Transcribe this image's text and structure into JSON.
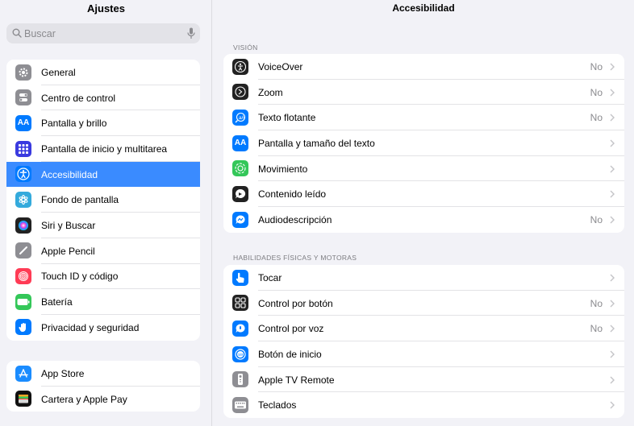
{
  "sidebar": {
    "title": "Ajustes",
    "search_placeholder": "Buscar",
    "items": [
      {
        "label": "General",
        "icon": "gear-icon",
        "color": "#8e8e93"
      },
      {
        "label": "Centro de control",
        "icon": "toggles-icon",
        "color": "#8e8e93"
      },
      {
        "label": "Pantalla y brillo",
        "icon": "text-size-icon",
        "color": "#007aff"
      },
      {
        "label": "Pantalla de inicio y multitarea",
        "icon": "grid-icon",
        "color": "#3a3adf"
      },
      {
        "label": "Accesibilidad",
        "icon": "accessibility-icon",
        "color": "#007aff"
      },
      {
        "label": "Fondo de pantalla",
        "icon": "flower-icon",
        "color": "#34aadc"
      },
      {
        "label": "Siri y Buscar",
        "icon": "siri-icon",
        "color": "#222222"
      },
      {
        "label": "Apple Pencil",
        "icon": "pencil-icon",
        "color": "#8e8e93"
      },
      {
        "label": "Touch ID y código",
        "icon": "fingerprint-icon",
        "color": "#ff3b55"
      },
      {
        "label": "Batería",
        "icon": "battery-icon",
        "color": "#34c759"
      },
      {
        "label": "Privacidad y seguridad",
        "icon": "hand-icon",
        "color": "#007aff"
      }
    ],
    "items2": [
      {
        "label": "App Store",
        "icon": "app-store-icon",
        "color": "#1a8cff"
      },
      {
        "label": "Cartera y Apple Pay",
        "icon": "wallet-icon",
        "color": "#111111"
      }
    ]
  },
  "main": {
    "title": "Accesibilidad",
    "sections": [
      {
        "header": "VISIÓN",
        "rows": [
          {
            "label": "VoiceOver",
            "value": "No",
            "icon": "voiceover-icon",
            "color": "#222222"
          },
          {
            "label": "Zoom",
            "value": "No",
            "icon": "zoom-icon",
            "color": "#222222"
          },
          {
            "label": "Texto flotante",
            "value": "No",
            "icon": "hover-text-icon",
            "color": "#007aff"
          },
          {
            "label": "Pantalla y tamaño del texto",
            "value": "",
            "icon": "text-size-icon",
            "color": "#007aff"
          },
          {
            "label": "Movimiento",
            "value": "",
            "icon": "motion-icon",
            "color": "#34c759"
          },
          {
            "label": "Contenido leído",
            "value": "",
            "icon": "spoken-content-icon",
            "color": "#222222"
          },
          {
            "label": "Audiodescripción",
            "value": "No",
            "icon": "audio-description-icon",
            "color": "#007aff"
          }
        ]
      },
      {
        "header": "HABILIDADES FÍSICAS Y MOTORAS",
        "rows": [
          {
            "label": "Tocar",
            "value": "",
            "icon": "touch-icon",
            "color": "#007aff"
          },
          {
            "label": "Control por botón",
            "value": "No",
            "icon": "switch-control-icon",
            "color": "#222222"
          },
          {
            "label": "Control por voz",
            "value": "No",
            "icon": "voice-control-icon",
            "color": "#007aff"
          },
          {
            "label": "Botón de inicio",
            "value": "",
            "icon": "home-button-icon",
            "color": "#007aff"
          },
          {
            "label": "Apple TV Remote",
            "value": "",
            "icon": "remote-icon",
            "color": "#8e8e93"
          },
          {
            "label": "Teclados",
            "value": "",
            "icon": "keyboard-icon",
            "color": "#8e8e93"
          }
        ]
      }
    ]
  }
}
